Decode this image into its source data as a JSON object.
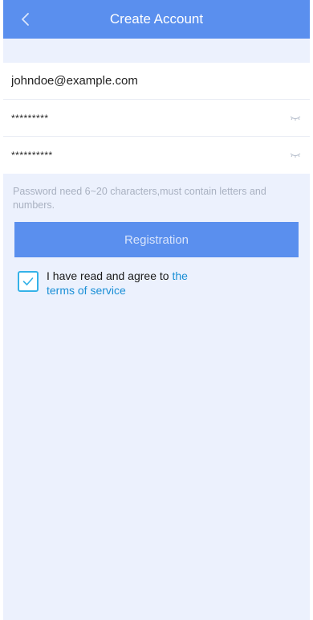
{
  "header": {
    "title": "Create Account",
    "back_icon": "chevron-left-icon"
  },
  "form": {
    "email_value": "johndoe@example.com",
    "password_value": "*********",
    "confirm_password_value": "**********",
    "password_toggle_icon": "eye-closed-icon",
    "hint": "Password need 6~20 characters,must contain letters and numbers."
  },
  "register": {
    "label": "Registration"
  },
  "agreement": {
    "checked": true,
    "text": "I have read and agree to ",
    "link": "the terms of service"
  },
  "colors": {
    "header": "#5a8fee",
    "background": "#ecf1fd",
    "checkbox": "#35b2e8",
    "link": "#1a8fd6"
  }
}
